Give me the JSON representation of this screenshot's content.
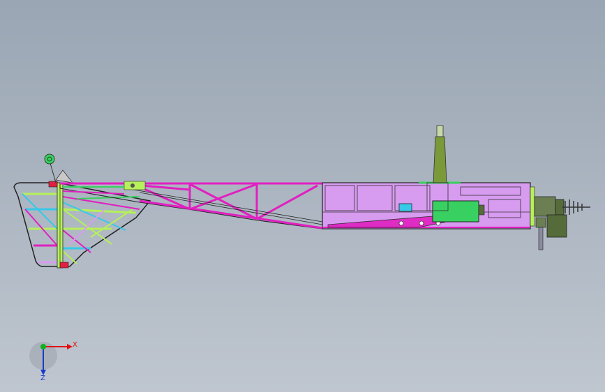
{
  "viewport": {
    "background_top": "#9aa6b4",
    "background_bottom": "#bfc6cf"
  },
  "model": {
    "name": "",
    "colors": {
      "magenta_frame": "#e020c0",
      "violet_panel": "#d79bf0",
      "lime_truss": "#b6f05a",
      "green_block": "#38d060",
      "olive_column": "#7a9a3a",
      "dark_olive": "#556b3a",
      "cyan_part": "#38c8e8",
      "outline": "#1a1a1a",
      "gearhead": "#6b7f52"
    }
  },
  "triad": {
    "x_label": "X",
    "z_label": "Z",
    "x_color": "#e01010",
    "y_color": "#10b020",
    "z_color": "#1a3cc8"
  }
}
